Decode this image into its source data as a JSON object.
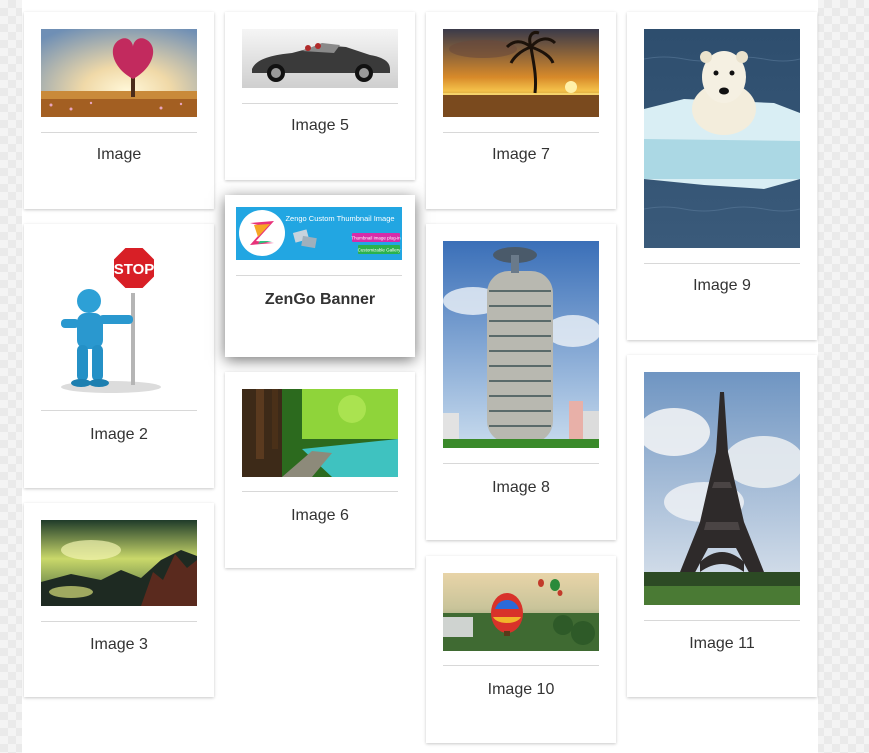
{
  "gallery": {
    "items": [
      {
        "caption": "Image",
        "icon": "heart-tree-image"
      },
      {
        "caption": "Image 2",
        "icon": "stop-sign-figure-image"
      },
      {
        "caption": "Image 3",
        "icon": "mountain-landscape-image"
      },
      {
        "caption": "Image 5",
        "icon": "sports-car-image"
      },
      {
        "caption": "ZenGo Banner",
        "icon": "zengo-banner-image",
        "banner": {
          "title": "Zengo Custom Thumbnail Image",
          "badge1": "Thumbnail image plug-in",
          "badge2": "Customizable Gallery"
        }
      },
      {
        "caption": "Image 6",
        "icon": "forest-lake-image"
      },
      {
        "caption": "Image 7",
        "icon": "palm-sunset-image"
      },
      {
        "caption": "Image 8",
        "icon": "tower-building-image"
      },
      {
        "caption": "Image 10",
        "icon": "hot-air-balloon-image"
      },
      {
        "caption": "Image 9",
        "icon": "polar-bear-image"
      },
      {
        "caption": "Image 11",
        "icon": "eiffel-tower-image"
      }
    ]
  }
}
